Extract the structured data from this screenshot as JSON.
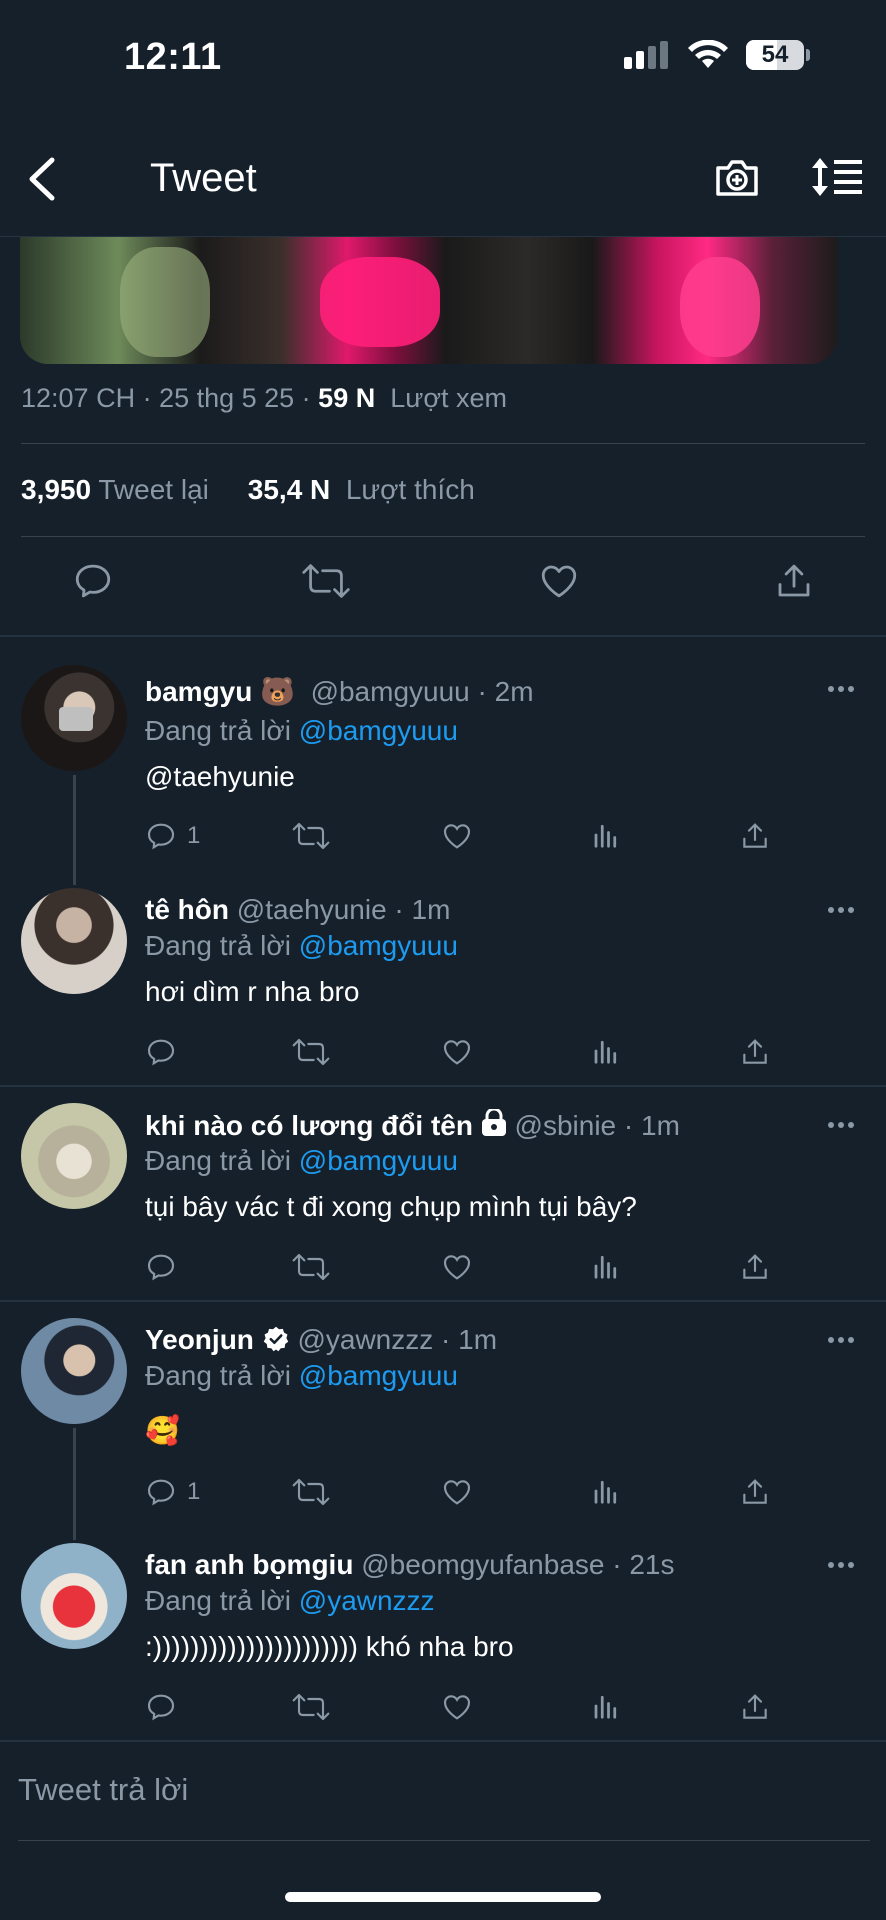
{
  "status_bar": {
    "time": "12:11",
    "battery": "54"
  },
  "nav": {
    "title": "Tweet"
  },
  "tweet": {
    "meta_time": "12:07 CH · 25 thg 5 25 · ",
    "views_count": "59 N",
    "views_label": "Lượt xem",
    "retweets_count": "3,950",
    "retweets_label": "Tweet lại",
    "likes_count": "35,4 N",
    "likes_label": "Lượt thích"
  },
  "replies": [
    {
      "name": "bamgyu 🐻",
      "handle": "@bamgyuuu · 2m",
      "reply_prefix": "Đang trả lời",
      "reply_to": "@bamgyuuu",
      "text": "@taehyunie",
      "reply_count": "1"
    },
    {
      "name": "tê hôn",
      "handle": "@taehyunie · 1m",
      "reply_prefix": "Đang trả lời",
      "reply_to": "@bamgyuuu",
      "text": "hơi dìm r nha bro",
      "reply_count": ""
    },
    {
      "name": "khi nào có lương đổi tên",
      "handle": "@sbinie · 1m",
      "reply_prefix": "Đang trả lời",
      "reply_to": "@bamgyuuu",
      "text": "tụi bây vác t đi xong chụp mình tụi bây?",
      "reply_count": ""
    },
    {
      "name": "Yeonjun",
      "handle": "@yawnzzz · 1m",
      "reply_prefix": "Đang trả lời",
      "reply_to": "@bamgyuuu",
      "text": "🥰",
      "reply_count": "1"
    },
    {
      "name": "fan anh bọmgiu",
      "handle": "@beomgyufanbase · 21s",
      "reply_prefix": "Đang trả lời",
      "reply_to": "@yawnzzz",
      "text": ":)))))))))))))))))))))) khó nha bro",
      "reply_count": ""
    }
  ],
  "compose": {
    "placeholder": "Tweet trả lời"
  },
  "colors": {
    "background": "#15202b",
    "muted": "#8b98a5",
    "link": "#1d9bf0",
    "divider": "#38444d"
  },
  "icons": [
    "back-arrow-icon",
    "camera-add-icon",
    "sort-icon",
    "comment-icon",
    "retweet-icon",
    "heart-icon",
    "share-icon",
    "analytics-icon",
    "more-icon",
    "verified-icon",
    "lock-icon"
  ]
}
